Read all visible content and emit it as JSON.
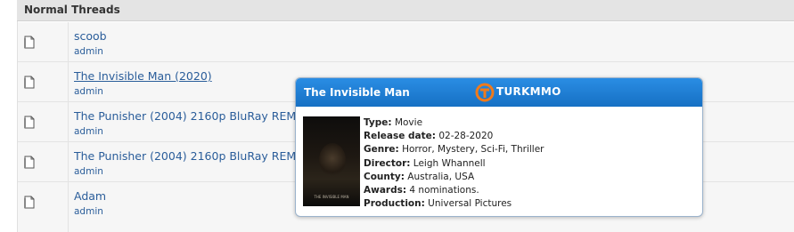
{
  "section": {
    "title": "Normal Threads"
  },
  "threads": [
    {
      "title": "scoob",
      "author": "admin"
    },
    {
      "title": "The Invisible Man (2020)",
      "author": "admin"
    },
    {
      "title": "The Punisher (2004) 2160p BluRay REMUX",
      "author": "admin"
    },
    {
      "title": "The Punisher (2004) 2160p BluRay REMUX",
      "author": "admin"
    },
    {
      "title": "Adam",
      "author": "admin"
    }
  ],
  "popup": {
    "title": "The Invisible Man",
    "brand": "TURKMMO",
    "poster_caption": "THE INVISIBLE MAN",
    "fields": [
      {
        "label": "Type:",
        "value": "Movie"
      },
      {
        "label": "Release date:",
        "value": "02-28-2020"
      },
      {
        "label": "Genre:",
        "value": "Horror, Mystery, Sci-Fi, Thriller"
      },
      {
        "label": "Director:",
        "value": "Leigh Whannell"
      },
      {
        "label": "County:",
        "value": "Australia, USA"
      },
      {
        "label": "Awards:",
        "value": "4 nominations."
      },
      {
        "label": "Production:",
        "value": "Universal Pictures"
      }
    ]
  },
  "colors": {
    "link": "#2a5d9a",
    "popup_header": "#1e7fd6",
    "brand_accent": "#f07a1a"
  }
}
